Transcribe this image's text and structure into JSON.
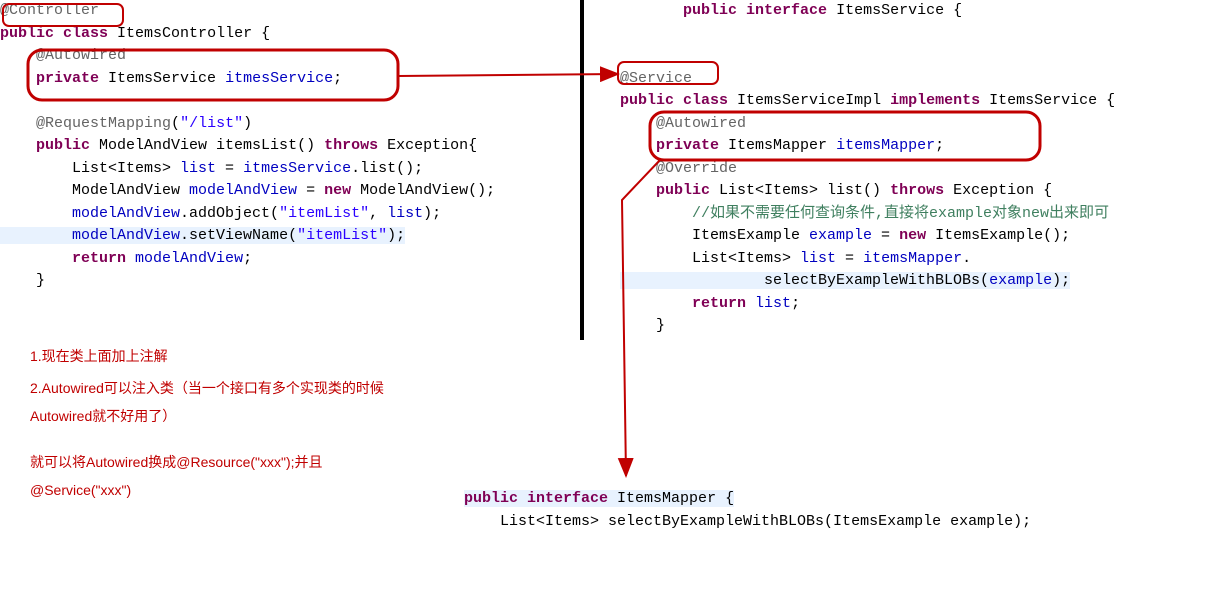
{
  "left": {
    "l1a": "@Controller",
    "l2a": "public",
    "l2b": "class",
    "l2c": " ItemsController {",
    "l3a": "@Autowired",
    "l4a": "private",
    "l4b": " ItemsService ",
    "l4c": "itmesService",
    "l4d": ";",
    "l5a": "@RequestMapping",
    "l5b": "(",
    "l5c": "\"/list\"",
    "l5d": ")",
    "l6a": "public",
    "l6b": " ModelAndView itemsList() ",
    "l6c": "throws",
    "l6d": " Exception{",
    "l7a": "        List<Items> ",
    "l7b": "list",
    "l7c": " = ",
    "l7d": "itmesService",
    "l7e": ".list();",
    "l8a": "        ModelAndView ",
    "l8b": "modelAndView",
    "l8c": " = ",
    "l8d": "new",
    "l8e": " ModelAndView();",
    "l9a": "        ",
    "l9b": "modelAndView",
    "l9c": ".addObject(",
    "l9d": "\"itemList\"",
    "l9e": ", ",
    "l9f": "list",
    "l9g": ");",
    "l10a": "        ",
    "l10b": "modelAndView",
    "l10c": ".setViewName(",
    "l10d": "\"itemList\"",
    "l10e": ");",
    "l11a": "        ",
    "l11b": "return",
    "l11c": " ",
    "l11d": "modelAndView",
    "l11e": ";",
    "l12a": "    }"
  },
  "right": {
    "r1a": "public",
    "r1b": " ",
    "r1c": "interface",
    "r1d": " ItemsService {",
    "r2a": "@Service",
    "r3a": "public",
    "r3b": " ",
    "r3c": "class",
    "r3d": " ItemsServiceImpl ",
    "r3e": "implements",
    "r3f": " ItemsService {",
    "r4a": "@Autowired",
    "r5a": "private",
    "r5b": " ItemsMapper ",
    "r5c": "itemsMapper",
    "r5d": ";",
    "r6a": "@Override",
    "r7a": "public",
    "r7b": " List<Items> list() ",
    "r7c": "throws",
    "r7d": " Exception {",
    "r8a": "        ",
    "r8b": "//如果不需要任何查询条件,直接将example对象new出来即可",
    "r9a": "        ItemsExample ",
    "r9b": "example",
    "r9c": " = ",
    "r9d": "new",
    "r9e": " ItemsExample();",
    "r10a": "        List<Items> ",
    "r10b": "list",
    "r10c": " = ",
    "r10d": "itemsMapper",
    "r10e": ".",
    "r11a": "                selectByExampleWithBLOBs(",
    "r11b": "example",
    "r11c": ");",
    "r12a": "        ",
    "r12b": "return",
    "r12c": " ",
    "r12d": "list",
    "r12e": ";",
    "r13a": "    }"
  },
  "bottom": {
    "b1a": "public",
    "b1b": " ",
    "b1c": "interface",
    "b1d": " ItemsMapper {",
    "b2a": "    List<Items> selectByExampleWithBLOBs(ItemsExample example);"
  },
  "notes": {
    "n1": "1.现在类上面加上注解",
    "n2": "2.Autowired可以注入类（当一个接口有多个实现类的时候Autowired就不好用了）",
    "n3": "就可以将Autowired换成@Resource(\"xxx\");并且@Service(\"xxx\")"
  }
}
